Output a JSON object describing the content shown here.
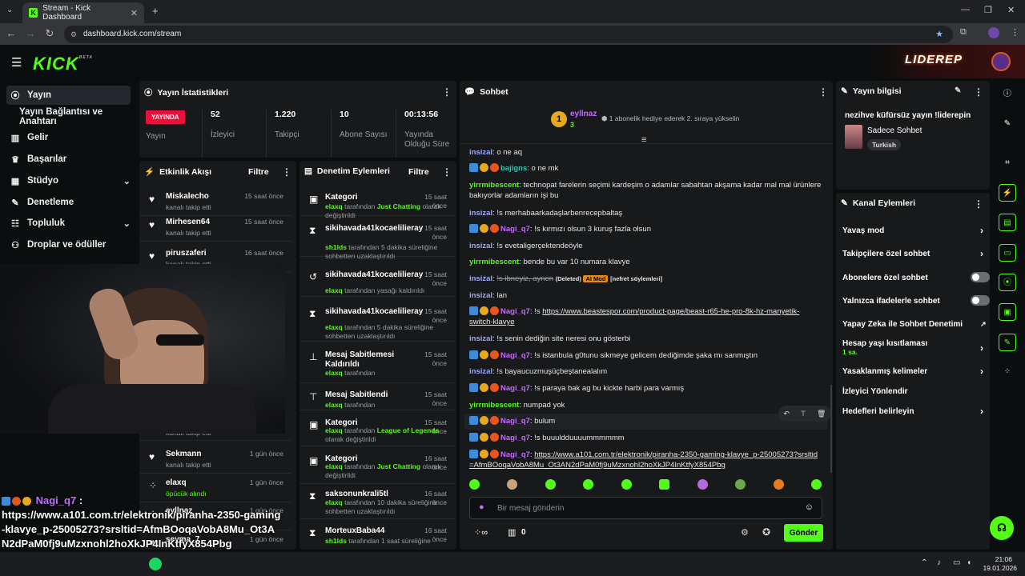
{
  "browser": {
    "tab_title": "Stream - Kick Dashboard",
    "url": "dashboard.kick.com/stream"
  },
  "header": {
    "logo": "KICK",
    "logo_sup": "BETA",
    "banner_text": "LIDEREP"
  },
  "sidebar": {
    "items": [
      {
        "label": "Yayın"
      },
      {
        "label": "Yayın Bağlantısı ve Anahtarı"
      },
      {
        "label": "Gelir"
      },
      {
        "label": "Başarılar"
      },
      {
        "label": "Stüdyo"
      },
      {
        "label": "Denetleme"
      },
      {
        "label": "Topluluk"
      },
      {
        "label": "Droplar ve ödüller"
      }
    ]
  },
  "stats": {
    "title": "Yayın İstatistikleri",
    "live_badge": "YAYINDA",
    "live_label": "Yayın",
    "viewers": "52",
    "viewers_label": "İzleyici",
    "followers": "1.220",
    "followers_label": "Takipçi",
    "subs": "10",
    "subs_label": "Abone Sayısı",
    "uptime": "00:13:56",
    "uptime_label": "Yayında Olduğu Süre"
  },
  "activity": {
    "title": "Etkinlik Akışı",
    "filter": "Filtre",
    "events": [
      {
        "name": "Miskalecho",
        "sub": "kanalı takip etti",
        "time": "15 saat önce"
      },
      {
        "name": "Mirhesen64",
        "sub": "kanalı takip etti",
        "time": "15 saat önce"
      },
      {
        "name": "piruszaferi",
        "sub": "kanalı takip etti",
        "time": "16 saat önce"
      },
      {
        "name": "",
        "sub": "kanalı takip etti",
        "time": ""
      },
      {
        "name": "Sekmann",
        "sub": "kanalı takip etti",
        "time": "1 gün önce"
      },
      {
        "name": "elaxq",
        "sub": "öpücük alındı",
        "time": "1 gün önce"
      },
      {
        "name": "eyllnaz",
        "sub": "",
        "time": "1 gün önce"
      },
      {
        "name": "seyma_7",
        "sub": "",
        "time": "1 gün önce"
      }
    ]
  },
  "moderation": {
    "title": "Denetim Eylemleri",
    "filter": "Filtre",
    "actions": [
      {
        "title": "Kategori",
        "time": "15 saat önce",
        "user": "elaxq",
        "pre": " tarafından ",
        "hl": "Just Chatting",
        "post": " olarak değiştirildi"
      },
      {
        "title": "sikihavada41kocaelilieray",
        "time": "15 saat önce",
        "user": "sh1lds",
        "pre": " tarafından 5 dakika süreliğine sohbetten uzaklaştırıldı",
        "hl": "",
        "post": ""
      },
      {
        "title": "sikihavada41kocaelilieray",
        "time": "15 saat önce",
        "user": "elaxq",
        "pre": " tarafından yasağı kaldırıldı",
        "hl": "",
        "post": ""
      },
      {
        "title": "sikihavada41kocaelilieray",
        "time": "15 saat önce",
        "user": "elaxq",
        "pre": " tarafından 5 dakika süreliğine sohbetten uzaklaştırıldı",
        "hl": "",
        "post": ""
      },
      {
        "title": "Mesaj Sabitlemesi Kaldırıldı",
        "time": "15 saat önce",
        "user": "elaxq",
        "pre": " tarafından",
        "hl": "",
        "post": ""
      },
      {
        "title": "Mesaj Sabitlendi",
        "time": "15 saat önce",
        "user": "elaxq",
        "pre": " tarafından",
        "hl": "",
        "post": ""
      },
      {
        "title": "Kategori",
        "time": "15 saat önce",
        "user": "elaxq",
        "pre": " tarafından ",
        "hl": "League of Legends",
        "post": " olarak değiştirildi"
      },
      {
        "title": "Kategori",
        "time": "16 saat önce",
        "user": "elaxq",
        "pre": " tarafından ",
        "hl": "Just Chatting",
        "post": " olarak değiştirildi"
      },
      {
        "title": "saksonunkrali5tl",
        "time": "16 saat önce",
        "user": "elaxq",
        "pre": " tarafından 10 dakika süreliğine sohbetten uzaklaştırıldı",
        "hl": "",
        "post": ""
      },
      {
        "title": "MorteuxBaba44",
        "time": "16 saat önce",
        "user": "sh1lds",
        "pre": " tarafından 1 saat süreliğine",
        "hl": "",
        "post": ""
      }
    ]
  },
  "chat": {
    "title": "Sohbet",
    "gifter": "eyllnaz",
    "gifter_count": "3",
    "gift_note": "1 abonelik hediye ederek 2. sıraya yükselin",
    "messages": [
      {
        "user": "insizal",
        "text": "o ne aq"
      },
      {
        "user": "bajigns",
        "text": "o ne mk"
      },
      {
        "user": "yirrmibescent",
        "text": "technopat farelerin seçimi kardeşim o adamlar sabahtan akşama kadar mal mal ürünlere bakıyorlar adamların işi bu"
      },
      {
        "user": "insizal",
        "text": "!s merhabaarkadaşlarbenrecepbaltaş"
      },
      {
        "user": "Nagi_q7",
        "text": "!s kırmızı olsun 3 kuruş fazla olsun"
      },
      {
        "user": "insizal",
        "text": "!s evetaligerçektendeöyle"
      },
      {
        "user": "yirrmibescent",
        "text": "bende bu var 10 numara klavye"
      },
      {
        "user": "insizal",
        "text": "!s ibneyiz, aynen",
        "deleted": "(Deleted)",
        "ai": "AI Mod",
        "reason": "[nefret söylemleri]"
      },
      {
        "user": "insizal",
        "text": "lan"
      },
      {
        "user": "Nagi_q7",
        "text": "!s ",
        "link": "https://www.beastespor.com/product-page/beast-r65-he-pro-8k-hz-manyetik-switch-klavye"
      },
      {
        "user": "insizal",
        "text": "!s senin dediğin site neresi onu gösterbi"
      },
      {
        "user": "Nagi_q7",
        "text": "!s istanbula g0tunu sikmeye gelicem dediğimde şaka mı sanmıştın"
      },
      {
        "user": "insizal",
        "text": "!s bayaucuzmuşüçbeştanealalım"
      },
      {
        "user": "Nagi_q7",
        "text": "!s paraya bak ag bu kickte harbi para varmış"
      },
      {
        "user": "yirrmibescent",
        "text": "numpad yok"
      },
      {
        "user": "Nagi_q7",
        "text": "bulum"
      },
      {
        "user": "Nagi_q7",
        "text": "!s buuuldduuuummmmmm"
      },
      {
        "user": "Nagi_q7",
        "text": "",
        "link": "https://www.a101.com.tr/elektronik/piranha-2350-gaming-klavye_p-25005273?srsltid=AfmBOoqaVobA8Mu_Ot3AN2dPaM0fj9uMzxnohl2hoXkJP4InKtfyX854Pbg"
      }
    ],
    "input_placeholder": "Bir mesaj gönderin",
    "points": "0",
    "send": "Gönder"
  },
  "stream_info": {
    "title": "Yayın bilgisi",
    "stream_title": "nezihve küfürsüz yayın !liderepin",
    "category": "Sadece Sohbet",
    "language": "Turkish"
  },
  "channel_actions": {
    "title": "Kanal Eylemleri",
    "items": [
      {
        "label": "Yavaş mod",
        "type": "chevron"
      },
      {
        "label": "Takipçilere özel sohbet",
        "type": "chevron"
      },
      {
        "label": "Abonelere özel sohbet",
        "type": "toggle"
      },
      {
        "label": "Yalnızca ifadelerle sohbet",
        "type": "toggle"
      },
      {
        "label": "Yapay Zeka ile Sohbet Denetimi",
        "type": "external"
      },
      {
        "label": "Hesap yaşı kısıtlaması",
        "type": "chevron",
        "sub": "1 sa."
      },
      {
        "label": "Yasaklanmış kelimeler",
        "type": "chevron"
      },
      {
        "label": "İzleyici Yönlendir",
        "type": "none"
      },
      {
        "label": "Hedefleri belirleyin",
        "type": "chevron"
      }
    ]
  },
  "overlay": {
    "user": "Nagi_q7",
    "text": "https://www.a101.com.tr/elektronik/piranha-2350-gaming-klavye_p-25005273?srsltid=AfmBOoqaVobA8Mu_Ot3AN2dPaM0fj9uMzxnohl2hoXkJP4InKtfyX854Pbg"
  },
  "taskbar": {
    "time": "21:06",
    "date": "19.01.2026"
  },
  "colors": {
    "accent": "#53fc18",
    "live": "#e9113c",
    "panel": "#18191b",
    "bg": "#0b0e0f"
  }
}
